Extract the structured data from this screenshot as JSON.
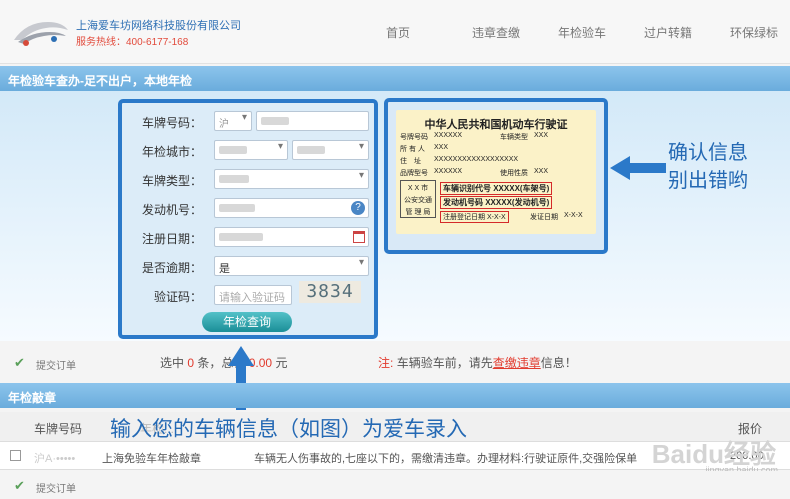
{
  "header": {
    "company": "上海爱车坊网络科技股份有限公司",
    "hotline": "服务热线：400-6177-168",
    "nav": [
      "首页",
      "违章查缴",
      "年检验车",
      "过户转籍",
      "环保绿标"
    ]
  },
  "section1": {
    "title": "年检验车查办-足不出户，本地年检"
  },
  "form": {
    "plate_label": "车牌号码：",
    "plate_prefix": "沪",
    "city_label": "年检城市：",
    "type_label": "车牌类型：",
    "engine_label": "发动机号：",
    "register_label": "注册日期：",
    "overdue_label": "是否逾期：",
    "overdue_value": "是",
    "captcha_label": "验证码：",
    "captcha_placeholder": "请输入验证码",
    "captcha_image": "3834",
    "submit": "年检查询"
  },
  "license_card": {
    "title": "中华人民共和国机动车行驶证",
    "plate_no": "号牌号码",
    "plate_val": "XXXXXX",
    "vehicle_type": "车辆类型",
    "vehicle_type_val": "XXX",
    "owner": "所 有 人",
    "owner_val": "XXX",
    "address": "住　址",
    "address_val": "XXXXXXXXXXXXXXXXXX",
    "model": "品牌型号",
    "model_val": "XXXXXX",
    "use_nature": "使用性质",
    "use_nature_val": "XXX",
    "vin_label": "车辆识别代号 XXXXX(车架号)",
    "engine_no_label": "发动机号码 XXXXX(发动机号)",
    "register_date": "注册登记日期",
    "register_date_val": "X-X-X",
    "issue_date": "发证日期",
    "issue_date_val": "X-X-X",
    "stamp": [
      "X X 市",
      "公安交通",
      "管 理 局"
    ]
  },
  "callout_right": [
    "确认信息",
    "别出错哟"
  ],
  "order_bar": {
    "submit_order": "提交订单",
    "selected_prefix": "选中",
    "selected_count": "0",
    "selected_suffix": "条，总计",
    "total": "0.00",
    "currency": "元",
    "note_prefix": "注:",
    "note_text": "车辆验车前，请先",
    "note_link": "查缴违章",
    "note_suffix": "信息！"
  },
  "section2": {
    "title": "年检敲章"
  },
  "table": {
    "headers": [
      "车牌号码",
      "年检...",
      "报价"
    ],
    "row": {
      "plate": "沪A·•••••",
      "service": "上海免验车年检敲章",
      "desc": "车辆无人伤事故的,七座以下的，需缴清违章。办理材料:行驶证原件,交强险保单",
      "price": "200.00"
    }
  },
  "callout_bottom": "输入您的车辆信息（如图）为爱车录入",
  "watermark": {
    "main": "Baidu经验",
    "sub": "jingyan.baidu.com"
  },
  "order_bar2": {
    "submit_order": "提交订单"
  },
  "colors": {
    "accent": "#2b79c9",
    "red": "#e23b2e",
    "banner": "#7bb8e4"
  }
}
